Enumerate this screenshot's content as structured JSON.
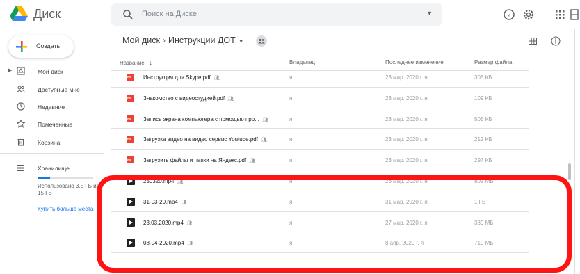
{
  "app": {
    "name": "Диск"
  },
  "search": {
    "placeholder": "Поиск на Диске"
  },
  "sidebar": {
    "create_label": "Создать",
    "items": [
      {
        "label": "Мой диск",
        "icon": "drive-icon"
      },
      {
        "label": "Доступные мне",
        "icon": "shared-icon"
      },
      {
        "label": "Недавние",
        "icon": "clock-icon"
      },
      {
        "label": "Помеченные",
        "icon": "star-icon"
      },
      {
        "label": "Корзина",
        "icon": "trash-icon"
      }
    ],
    "storage": {
      "label": "Хранилище",
      "used_text": "Использовано 3,5 ГБ из 15 ГБ",
      "used_fraction": 0.23,
      "buy_label": "Купить больше места"
    }
  },
  "breadcrumb": {
    "root": "Мой диск",
    "current": "Инструкции ДОТ"
  },
  "columns": {
    "name": "Название",
    "owner": "Владелец",
    "modified": "Последнее изменение",
    "size": "Размер файла"
  },
  "files": [
    {
      "name": "Инструкция для Skype.pdf",
      "type": "pdf",
      "owner": "я",
      "modified": "23 мар. 2020 г. я",
      "size": "305 КБ"
    },
    {
      "name": "Знакомство с видеостудией.pdf",
      "type": "pdf",
      "owner": "я",
      "modified": "23 мар. 2020 г. я",
      "size": "109 КБ"
    },
    {
      "name": "Запись экрана компьютера с помощью про...",
      "type": "pdf",
      "owner": "я",
      "modified": "23 мар. 2020 г. я",
      "size": "505 КБ"
    },
    {
      "name": "Загрузка видео на видео сервис Youtube.pdf",
      "type": "pdf",
      "owner": "я",
      "modified": "23 мар. 2020 г. я",
      "size": "212 КБ"
    },
    {
      "name": "Загрузить файлы и папки на Яндекс.pdf",
      "type": "pdf",
      "owner": "я",
      "modified": "23 мар. 2020 г. я",
      "size": "297 КБ"
    },
    {
      "name": "250320.mp4",
      "type": "video",
      "owner": "я",
      "modified": "26 мар. 2020 г. я",
      "size": "802 МБ"
    },
    {
      "name": "31-03-20.mp4",
      "type": "video",
      "owner": "я",
      "modified": "31 мар. 2020 г. я",
      "size": "1 ГБ"
    },
    {
      "name": "23,03,2020.mp4",
      "type": "video",
      "owner": "я",
      "modified": "27 мар. 2020 г. я",
      "size": "389 МБ"
    },
    {
      "name": "08-04-2020.mp4",
      "type": "video",
      "owner": "я",
      "modified": "8 апр. 2020 г. я",
      "size": "710 МБ"
    }
  ],
  "colors": {
    "highlight": "#ff1414",
    "accent": "#1a73e8",
    "pdf": "#ea4335"
  }
}
